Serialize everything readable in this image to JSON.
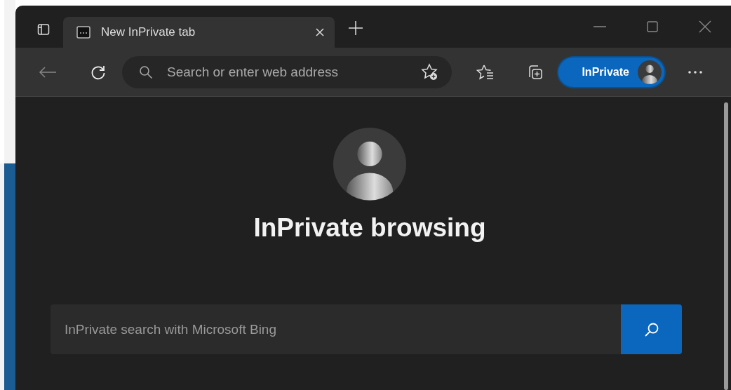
{
  "tabs": [
    {
      "title": "New InPrivate tab",
      "selected": true
    }
  ],
  "address_bar": {
    "placeholder": "Search or enter web address"
  },
  "profile_button": {
    "label": "InPrivate"
  },
  "page": {
    "heading": "InPrivate browsing",
    "search": {
      "placeholder": "InPrivate search with Microsoft Bing"
    }
  }
}
